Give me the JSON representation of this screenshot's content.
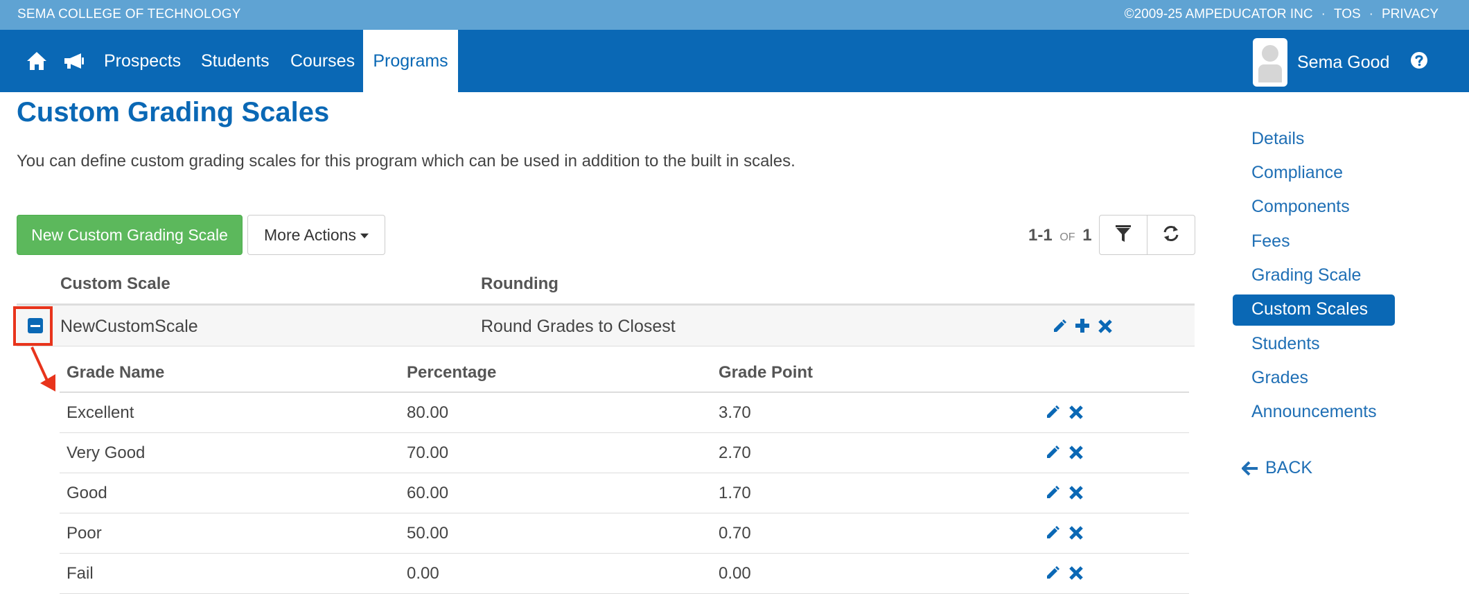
{
  "topbar": {
    "org_name": "SEMA COLLEGE OF TECHNOLOGY",
    "copyright": "©2009-25 AMPEDUCATOR INC",
    "tos": "TOS",
    "privacy": "PRIVACY",
    "separator": "·"
  },
  "navbar": {
    "icons": [
      "home-icon",
      "megaphone-icon"
    ],
    "links": [
      "Prospects",
      "Students",
      "Courses",
      "Programs"
    ],
    "active_link": "Programs",
    "user_name": "Sema Good",
    "help_icon": "question-circle-icon"
  },
  "page": {
    "title": "Custom Grading Scales",
    "description": "You can define custom grading scales for this program which can be used in addition to the built in scales."
  },
  "toolbar": {
    "new_button": "New Custom Grading Scale",
    "more_actions": "More Actions",
    "pager_range": "1-1",
    "pager_of": "OF",
    "pager_total": "1",
    "filter_icon": "filter-icon",
    "refresh_icon": "refresh-icon"
  },
  "table": {
    "headers": [
      "Custom Scale",
      "Rounding"
    ],
    "row": {
      "name": "NewCustomScale",
      "rounding": "Round Grades to Closest"
    }
  },
  "subtable": {
    "headers": [
      "Grade Name",
      "Percentage",
      "Grade Point"
    ],
    "rows": [
      {
        "name": "Excellent",
        "percentage": "80.00",
        "grade_point": "3.70"
      },
      {
        "name": "Very Good",
        "percentage": "70.00",
        "grade_point": "2.70"
      },
      {
        "name": "Good",
        "percentage": "60.00",
        "grade_point": "1.70"
      },
      {
        "name": "Poor",
        "percentage": "50.00",
        "grade_point": "0.70"
      },
      {
        "name": "Fail",
        "percentage": "0.00",
        "grade_point": "0.00"
      }
    ]
  },
  "sidebar": {
    "items": [
      "Details",
      "Compliance",
      "Components",
      "Fees",
      "Grading Scale",
      "Custom Scales",
      "Students",
      "Grades",
      "Announcements"
    ],
    "active_item": "Custom Scales",
    "back": "BACK"
  },
  "colors": {
    "brand_blue": "#0a68b5",
    "topbar_blue": "#5fa3d3",
    "green": "#5cb85c",
    "annotation_red": "#e8341c"
  }
}
